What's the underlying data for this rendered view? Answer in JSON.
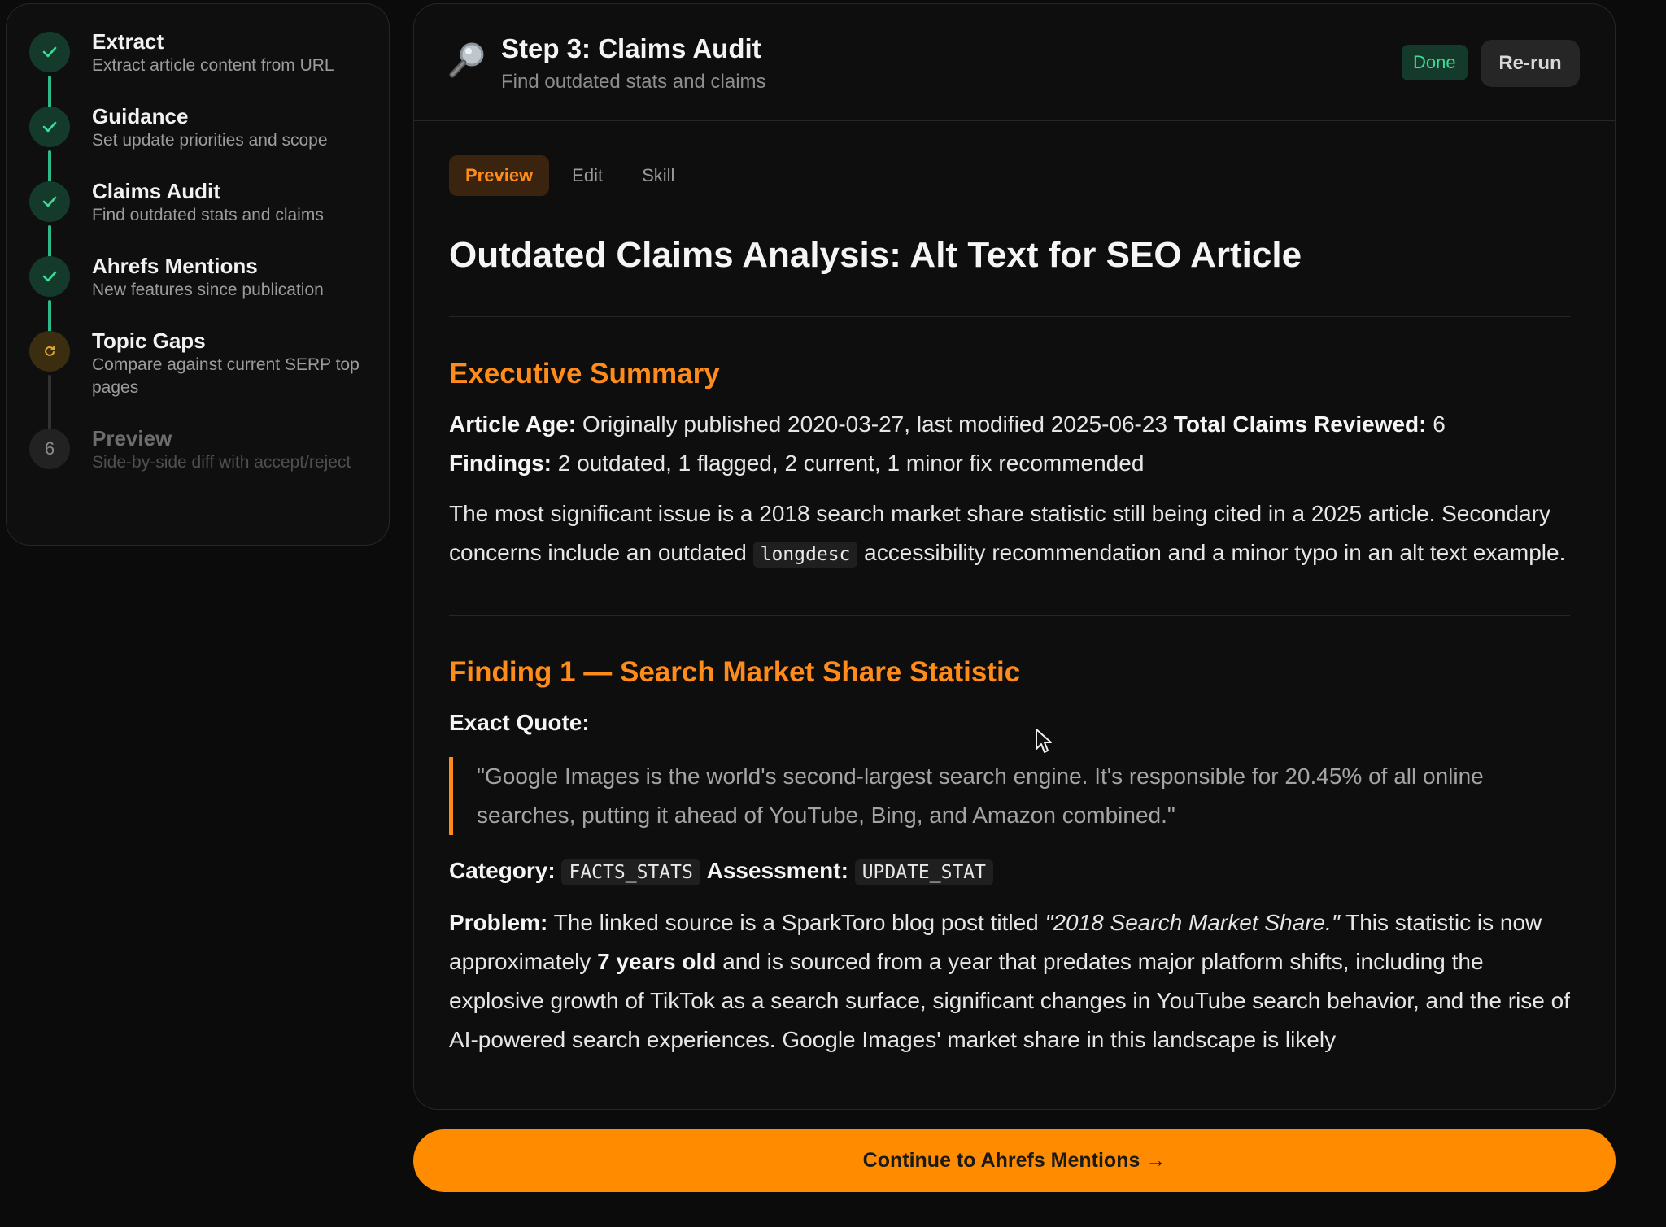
{
  "sidebar": {
    "steps": [
      {
        "title": "Extract",
        "subtitle": "Extract article content from URL",
        "status": "done"
      },
      {
        "title": "Guidance",
        "subtitle": "Set update priorities and scope",
        "status": "done"
      },
      {
        "title": "Claims Audit",
        "subtitle": "Find outdated stats and claims",
        "status": "done"
      },
      {
        "title": "Ahrefs Mentions",
        "subtitle": "New features since publication",
        "status": "done"
      },
      {
        "title": "Topic Gaps",
        "subtitle": "Compare against current SERP top pages",
        "status": "active"
      },
      {
        "title": "Preview",
        "subtitle": "Side-by-side diff with accept/reject",
        "status": "pending",
        "number": "6"
      }
    ]
  },
  "header": {
    "icon": "magnifier-icon",
    "title": "Step 3: Claims Audit",
    "subtitle": "Find outdated stats and claims",
    "status": "Done",
    "rerun_label": "Re-run"
  },
  "tabs": [
    "Preview",
    "Edit",
    "Skill"
  ],
  "doc": {
    "title": "Outdated Claims Analysis: Alt Text for SEO Article",
    "exec_summary": {
      "heading": "Executive Summary",
      "age_label": "Article Age:",
      "age_value": "Originally published 2020-03-27, last modified 2025-06-23",
      "claims_label": "Total Claims Reviewed:",
      "claims_value": "6",
      "findings_label": "Findings:",
      "findings_value": "2 outdated, 1 flagged, 2 current, 1 minor fix recommended",
      "para_part1": "The most significant issue is a 2018 search market share statistic still being cited in a 2025 article. Secondary concerns include an outdated",
      "para_code": "longdesc",
      "para_part2": "accessibility recommendation and a minor typo in an alt text example."
    },
    "finding1": {
      "heading": "Finding 1 — Search Market Share Statistic",
      "quote_label": "Exact Quote:",
      "quote": "\"Google Images is the world's second-largest search engine. It's responsible for 20.45% of all online searches, putting it ahead of YouTube, Bing, and Amazon combined.\"",
      "category_label": "Category:",
      "category_value": "FACTS_STATS",
      "assessment_label": "Assessment:",
      "assessment_value": "UPDATE_STAT",
      "problem_label": "Problem:",
      "problem_part1": "The linked source is a SparkToro blog post titled",
      "problem_title": "\"2018 Search Market Share.\"",
      "problem_part2": "This statistic is now approximately",
      "problem_bold": "7 years old",
      "problem_part3": "and is sourced from a year that predates major platform shifts, including the explosive growth of TikTok as a search surface, significant changes in YouTube search behavior, and the rise of AI-powered search experiences. Google Images' market share in this landscape is likely"
    }
  },
  "continue_label": "Continue to Ahrefs Mentions →",
  "colors": {
    "accent": "#ff8c00",
    "done_green": "#2fb98a",
    "background": "#0b0b0b"
  }
}
